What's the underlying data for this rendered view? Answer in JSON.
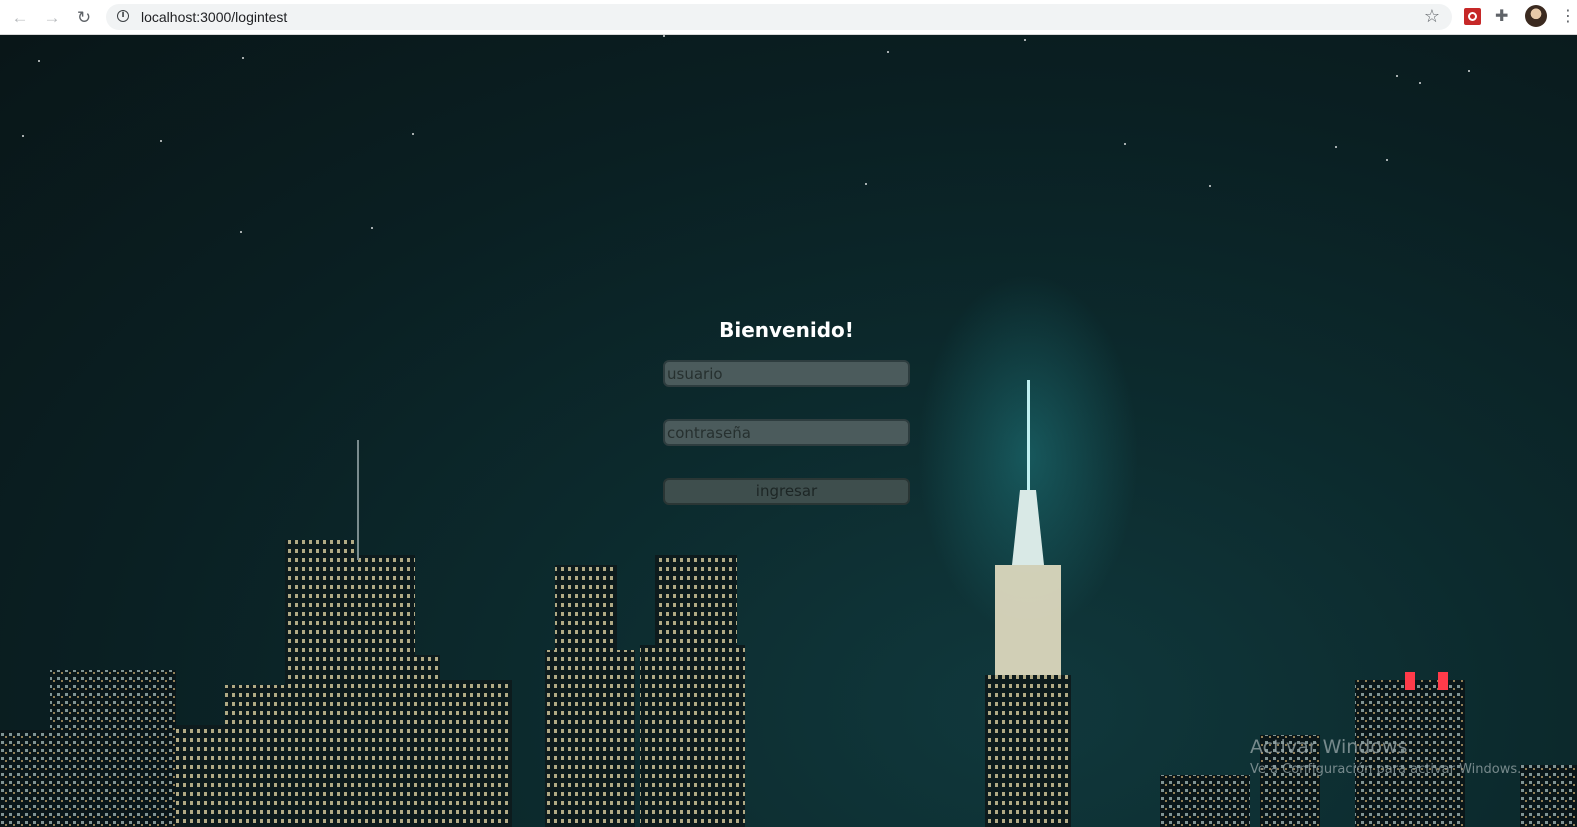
{
  "browser": {
    "url": "localhost:3000/logintest",
    "back_icon": "←",
    "forward_icon": "→",
    "reload_icon": "↻",
    "info_icon": "i",
    "star_icon": "☆",
    "extensions_icon": "✚",
    "menu_icon": "⋮"
  },
  "login": {
    "title": "Bienvenido!",
    "username_placeholder": "usuario",
    "password_placeholder": "contraseña",
    "submit_label": "ingresar"
  },
  "watermark": {
    "line1": "Activar Windows",
    "line2": "Ve a Configuración para activar Windows."
  }
}
